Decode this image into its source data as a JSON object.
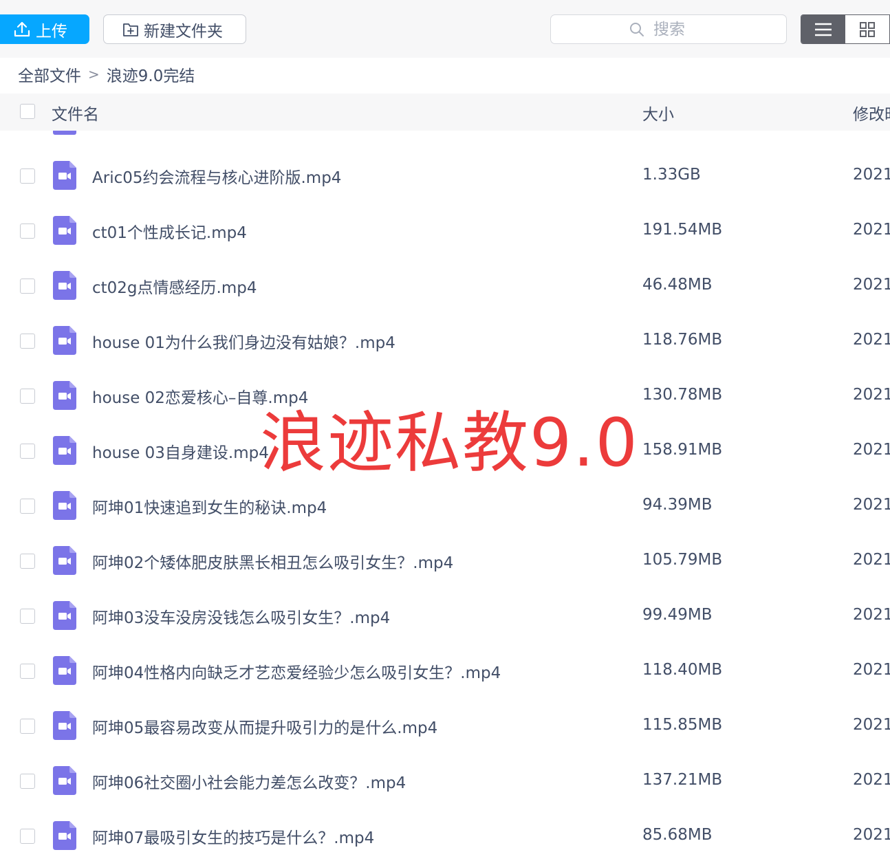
{
  "toolbar": {
    "upload_label": "上传",
    "new_folder_label": "新建文件夹",
    "search_placeholder": "搜索"
  },
  "breadcrumb": {
    "root": "全部文件",
    "separator": ">",
    "current": "浪迹9.0完结"
  },
  "table": {
    "col_name": "文件名",
    "col_size": "大小",
    "col_modified": "修改时"
  },
  "files": [
    {
      "name": "Aric05约会流程与核心进阶版.mp4",
      "size": "1.33GB",
      "date": "2021"
    },
    {
      "name": "ct01个性成长记.mp4",
      "size": "191.54MB",
      "date": "2021"
    },
    {
      "name": "ct02g点情感经历.mp4",
      "size": "46.48MB",
      "date": "2021"
    },
    {
      "name": "house 01为什么我们身边没有姑娘？.mp4",
      "size": "118.76MB",
      "date": "2021"
    },
    {
      "name": "house 02恋爱核心–自尊.mp4",
      "size": "130.78MB",
      "date": "2021"
    },
    {
      "name": "house 03自身建设.mp4",
      "size": "158.91MB",
      "date": "2021"
    },
    {
      "name": "阿坤01快速追到女生的秘诀.mp4",
      "size": "94.39MB",
      "date": "2021"
    },
    {
      "name": "阿坤02个矮体肥皮肤黑长相丑怎么吸引女生？.mp4",
      "size": "105.79MB",
      "date": "2021"
    },
    {
      "name": "阿坤03没车没房没钱怎么吸引女生？.mp4",
      "size": "99.49MB",
      "date": "2021"
    },
    {
      "name": "阿坤04性格内向缺乏才艺恋爱经验少怎么吸引女生？.mp4",
      "size": "118.40MB",
      "date": "2021"
    },
    {
      "name": "阿坤05最容易改变从而提升吸引力的是什么.mp4",
      "size": "115.85MB",
      "date": "2021"
    },
    {
      "name": "阿坤06社交圈小社会能力差怎么改变？.mp4",
      "size": "137.21MB",
      "date": "2021"
    },
    {
      "name": "阿坤07最吸引女生的技巧是什么？.mp4",
      "size": "85.68MB",
      "date": "2021"
    }
  ],
  "watermark": "浪迹私教9.0",
  "colors": {
    "accent": "#06a7ff",
    "video_icon": "#7b74e8",
    "text": "#424e67",
    "watermark": "#ec3b3b"
  },
  "icons": {
    "upload": "upload-icon",
    "new_folder": "folder-plus-icon",
    "search": "search-icon",
    "list_view": "list-view-icon",
    "grid_view": "grid-view-icon",
    "file": "video-file-icon"
  }
}
